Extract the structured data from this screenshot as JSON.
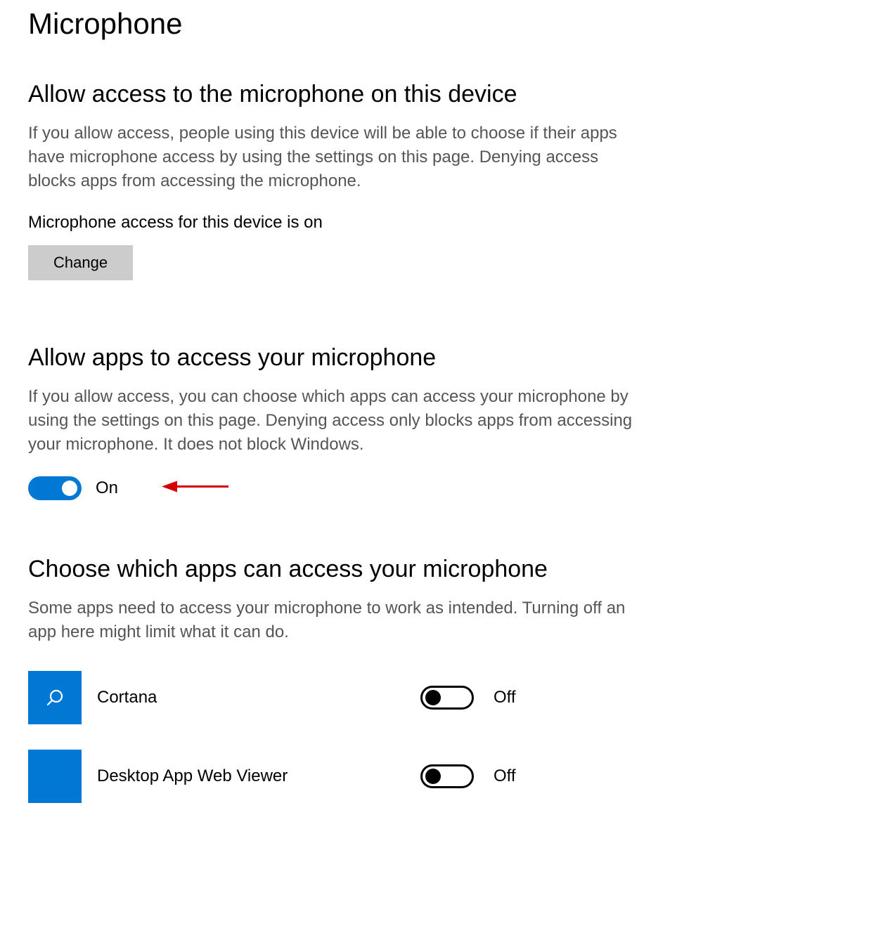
{
  "page": {
    "title": "Microphone"
  },
  "section_device": {
    "title": "Allow access to the microphone on this device",
    "desc": "If you allow access, people using this device will be able to choose if their apps have microphone access by using the settings on this page. Denying access blocks apps from accessing the microphone.",
    "status": "Microphone access for this device is on",
    "change_label": "Change"
  },
  "section_apps": {
    "title": "Allow apps to access your microphone",
    "desc": "If you allow access, you can choose which apps can access your microphone by using the settings on this page. Denying access only blocks apps from accessing your microphone. It does not block Windows.",
    "toggle_label": "On"
  },
  "section_choose": {
    "title": "Choose which apps can access your microphone",
    "desc": "Some apps need to access your microphone to work as intended. Turning off an app here might limit what it can do."
  },
  "apps": [
    {
      "name": "Cortana",
      "toggle_label": "Off",
      "icon": "search"
    },
    {
      "name": "Desktop App Web Viewer",
      "toggle_label": "Off",
      "icon": "blank"
    }
  ],
  "colors": {
    "accent": "#0078d4",
    "arrow": "#d40000"
  }
}
